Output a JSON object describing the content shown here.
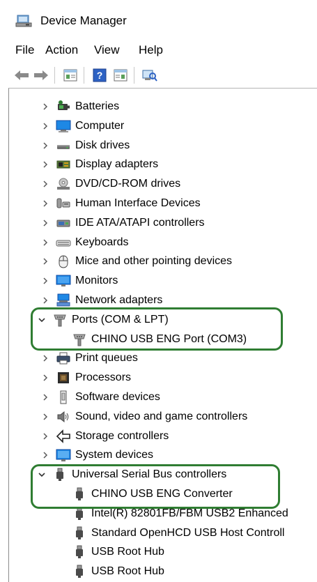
{
  "window": {
    "title": "Device Manager"
  },
  "menu": [
    {
      "label": "File"
    },
    {
      "label": "Action"
    },
    {
      "label": "View"
    },
    {
      "label": "Help"
    }
  ],
  "toolbar": {
    "buttons": [
      "back-arrow-icon",
      "forward-arrow-icon",
      "properties-icon",
      "help-icon",
      "update-driver-icon",
      "scan-hardware-icon"
    ]
  },
  "tree": [
    {
      "label": "Batteries",
      "icon": "battery-icon",
      "state": "collapsed"
    },
    {
      "label": "Computer",
      "icon": "computer-icon",
      "state": "collapsed"
    },
    {
      "label": "Disk drives",
      "icon": "disk-drive-icon",
      "state": "collapsed"
    },
    {
      "label": "Display adapters",
      "icon": "display-adapter-icon",
      "state": "collapsed"
    },
    {
      "label": "DVD/CD-ROM drives",
      "icon": "dvd-drive-icon",
      "state": "collapsed"
    },
    {
      "label": "Human Interface Devices",
      "icon": "hid-icon",
      "state": "collapsed"
    },
    {
      "label": "IDE ATA/ATAPI controllers",
      "icon": "ide-controller-icon",
      "state": "collapsed"
    },
    {
      "label": "Keyboards",
      "icon": "keyboard-icon",
      "state": "collapsed"
    },
    {
      "label": "Mice and other pointing devices",
      "icon": "mouse-icon",
      "state": "collapsed"
    },
    {
      "label": "Monitors",
      "icon": "monitor-icon",
      "state": "collapsed"
    },
    {
      "label": "Network adapters",
      "icon": "network-adapter-icon",
      "state": "collapsed"
    },
    {
      "label": "Ports (COM & LPT)",
      "icon": "port-icon",
      "state": "expanded"
    },
    {
      "label": "CHINO USB ENG Port (COM3)",
      "icon": "port-icon",
      "state": "child"
    },
    {
      "label": "Print queues",
      "icon": "printer-icon",
      "state": "collapsed"
    },
    {
      "label": "Processors",
      "icon": "processor-icon",
      "state": "collapsed"
    },
    {
      "label": "Software devices",
      "icon": "software-device-icon",
      "state": "collapsed"
    },
    {
      "label": "Sound, video and game controllers",
      "icon": "speaker-icon",
      "state": "collapsed"
    },
    {
      "label": "Storage controllers",
      "icon": "storage-controller-icon",
      "state": "collapsed"
    },
    {
      "label": "System devices",
      "icon": "system-device-icon",
      "state": "collapsed"
    },
    {
      "label": "Universal Serial Bus controllers",
      "icon": "usb-icon",
      "state": "expanded"
    },
    {
      "label": "CHINO USB ENG Converter",
      "icon": "usb-icon",
      "state": "child"
    },
    {
      "label": "Intel(R) 82801FB/FBM USB2 Enhanced",
      "icon": "usb-icon",
      "state": "child"
    },
    {
      "label": "Standard OpenHCD USB Host Controll",
      "icon": "usb-icon",
      "state": "child"
    },
    {
      "label": "USB Root Hub",
      "icon": "usb-icon",
      "state": "child"
    },
    {
      "label": "USB Root Hub",
      "icon": "usb-icon",
      "state": "child"
    }
  ],
  "colors": {
    "highlight": "#2f7d32",
    "chevron": "#595959"
  }
}
